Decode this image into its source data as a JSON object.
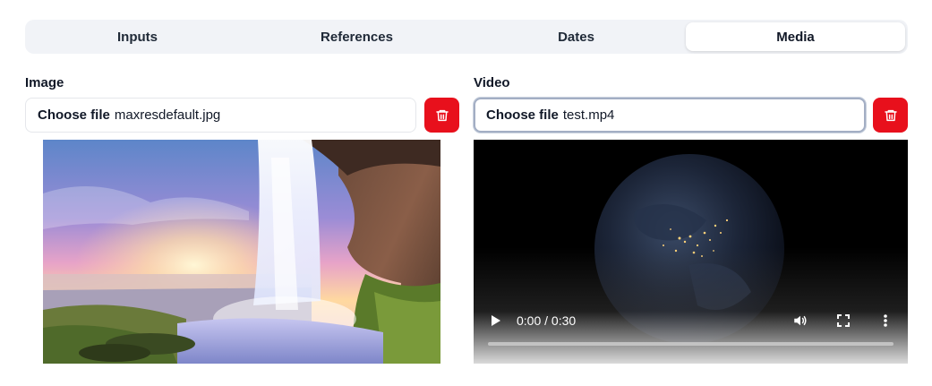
{
  "tabs": [
    {
      "label": "Inputs",
      "active": false
    },
    {
      "label": "References",
      "active": false
    },
    {
      "label": "Dates",
      "active": false
    },
    {
      "label": "Media",
      "active": true
    }
  ],
  "image": {
    "label": "Image",
    "button_text": "Choose file",
    "file_name": "maxresdefault.jpg"
  },
  "video": {
    "label": "Video",
    "button_text": "Choose file",
    "file_name": "test.mp4",
    "time": "0:00 / 0:30",
    "progress": 0
  },
  "colors": {
    "delete_button": "#e8101c",
    "tab_bar": "#f1f3f7"
  }
}
